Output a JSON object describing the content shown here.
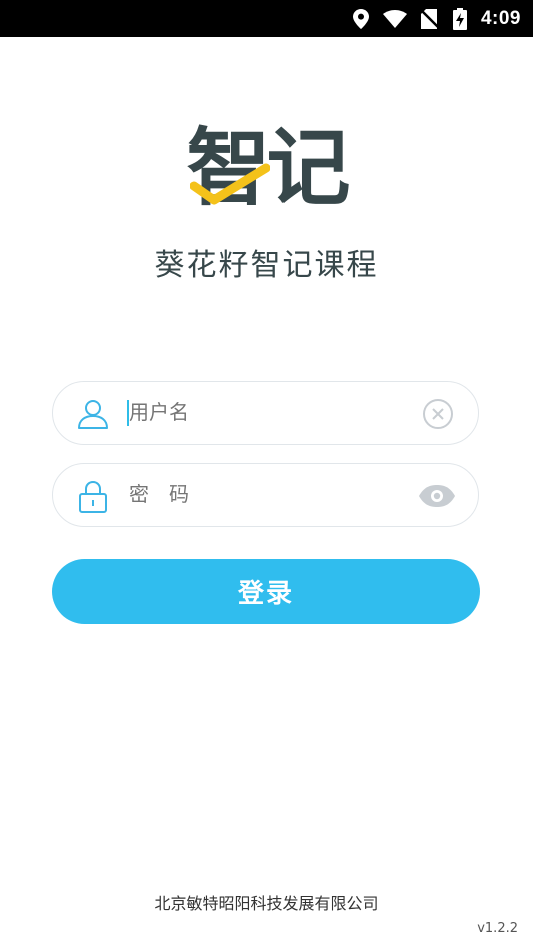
{
  "status_bar": {
    "time": "4:09",
    "icons": [
      "location-icon",
      "wifi-icon",
      "no-sim-icon",
      "battery-charging-icon"
    ]
  },
  "logo": {
    "text": "智记",
    "icon": "checkmark-icon",
    "check_color": "#f4c21a"
  },
  "app_title": "葵花籽智记课程",
  "username_field": {
    "placeholder": "用户名",
    "value": "",
    "leading_icon": "user-icon",
    "trailing_icon": "clear-icon"
  },
  "password_field": {
    "placeholder": "密　码",
    "value": "",
    "leading_icon": "lock-icon",
    "trailing_icon": "eye-icon"
  },
  "login_button": {
    "label": "登录"
  },
  "footer": {
    "company": "北京敏特昭阳科技发展有限公司",
    "version": "v1.2.2"
  },
  "colors": {
    "accent": "#30bdee",
    "icon_blue": "#3cb4e6",
    "logo_dark": "#37474a",
    "logo_check": "#f4c21a"
  }
}
